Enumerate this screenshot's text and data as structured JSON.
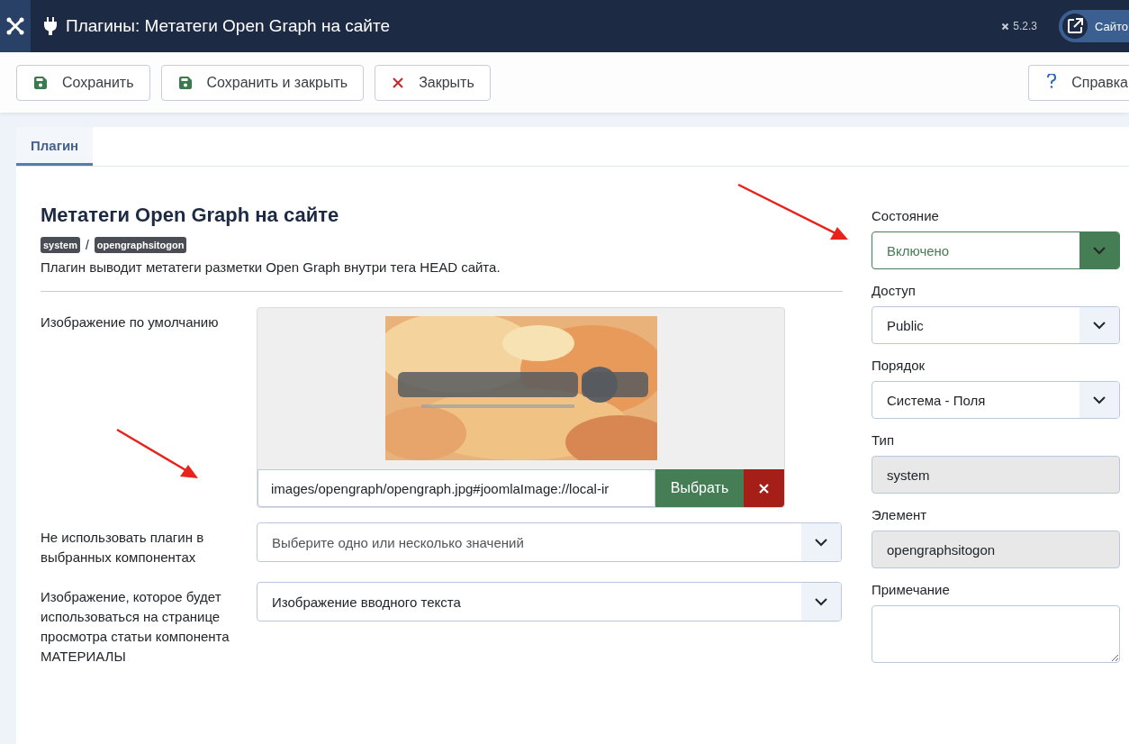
{
  "header": {
    "title": "Плагины: Метатеги Open Graph на сайте",
    "version": "5.2.3",
    "site_link": "Сайто"
  },
  "toolbar": {
    "buttons": [
      {
        "label": "Сохранить",
        "kind": "save"
      },
      {
        "label": "Сохранить и закрыть",
        "kind": "save"
      },
      {
        "label": "Закрыть",
        "kind": "close"
      }
    ],
    "help": {
      "label": "Справка",
      "kind": "help"
    }
  },
  "tabs": [
    {
      "label": "Плагин",
      "selected": true
    }
  ],
  "plugin": {
    "title": "Метатеги Open Graph на сайте",
    "badges": [
      "system",
      "opengraphsitogon"
    ],
    "separator": "/",
    "description": "Плагин выводит метатеги разметки Open Graph внутри тега HEAD сайта."
  },
  "fields": [
    {
      "label": "Изображение по умолчанию",
      "kind": "media",
      "value": "images/opengraph/opengraph.jpg#joomlaImage://local-ir",
      "button": "Выбрать"
    },
    {
      "label": "Не использовать плагин в выбранных компонентах",
      "kind": "multiselect",
      "placeholder": "Выберите одно или несколько значений"
    },
    {
      "label": "Изображение, которое будет использоваться на странице просмотра статьи компонента МАТЕРИАЛЫ",
      "kind": "select",
      "value": "Изображение вводного текста"
    }
  ],
  "sidebar_fields": [
    {
      "label": "Состояние",
      "kind": "status-select",
      "value": "Включено"
    },
    {
      "label": "Доступ",
      "kind": "select",
      "value": "Public"
    },
    {
      "label": "Порядок",
      "kind": "select",
      "value": "Система - Поля"
    },
    {
      "label": "Тип",
      "kind": "readonly",
      "value": "system"
    },
    {
      "label": "Элемент",
      "kind": "readonly",
      "value": "opengraphsitogon"
    },
    {
      "label": "Примечание",
      "kind": "textarea"
    }
  ]
}
